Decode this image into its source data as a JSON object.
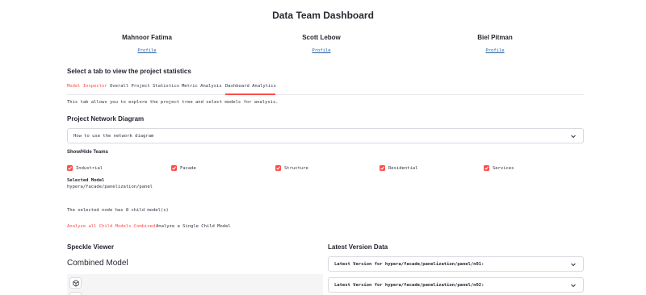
{
  "page_title": "Data Team Dashboard",
  "team": [
    {
      "name": "Mahnoor Fatima",
      "link": "Profile"
    },
    {
      "name": "Scott Lebow",
      "link": "Profile"
    },
    {
      "name": "Biel Pitman",
      "link": "Profile"
    }
  ],
  "tab_prompt": "Select a tab to view the project statistics",
  "tabs": [
    {
      "label": "Model Inspector",
      "active": true
    },
    {
      "label": "Overall Project Statistics",
      "active": false
    },
    {
      "label": "Metric Analysis",
      "active": false
    },
    {
      "label": "Dashboard Analytics",
      "active": false
    }
  ],
  "tab_description": "This tab allows you to explore the project tree and select models for analysis.",
  "network": {
    "heading": "Project Network Diagram",
    "help_expander": "How to use the network diagram"
  },
  "teams_toggle": {
    "heading": "Show/Hide Teams",
    "items": [
      {
        "label": "Industrial",
        "checked": true
      },
      {
        "label": "Facade",
        "checked": true
      },
      {
        "label": "Structure",
        "checked": true
      },
      {
        "label": "Residential",
        "checked": true
      },
      {
        "label": "Services",
        "checked": true
      }
    ]
  },
  "selected_model": {
    "title": "Selected Model",
    "path": "hypera/facade/panelization/panel"
  },
  "child_count_text": "The selected node has 8 child model(s)",
  "analysis_tabs": [
    {
      "label": "Analyze all Child Models Combined",
      "active": true
    },
    {
      "label": "Analyze a Single Child Model",
      "active": false
    }
  ],
  "speckle": {
    "heading": "Speckle Viewer",
    "subheading": "Combined Model",
    "cube_icon": "cube-icon"
  },
  "latest": {
    "heading": "Latest Version Data",
    "expanders": [
      "Latest Version for hypera/facade/panelization/panel/n01:",
      "Latest Version for hypera/facade/panelization/panel/n02:"
    ]
  },
  "colors": {
    "accent": "#ff4b4b",
    "text": "#31333f",
    "link": "#1f5fa0",
    "border": "#d8dae0"
  }
}
